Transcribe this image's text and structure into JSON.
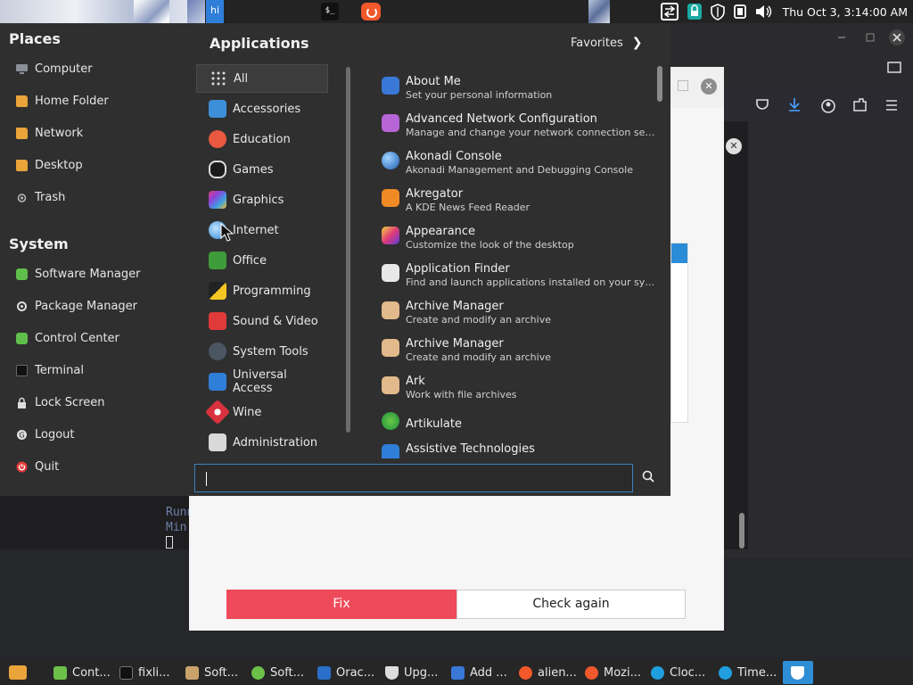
{
  "top_panel": {
    "hi_label": "hi",
    "term_icon_text": "$_",
    "clock": "Thu Oct  3,  3:14:00 AM"
  },
  "menu": {
    "places_title": "Places",
    "places": [
      {
        "label": "Computer",
        "icon": "computer-icon"
      },
      {
        "label": "Home Folder",
        "icon": "folder-icon"
      },
      {
        "label": "Network",
        "icon": "folder-icon"
      },
      {
        "label": "Desktop",
        "icon": "folder-icon"
      },
      {
        "label": "Trash",
        "icon": "trash-icon"
      }
    ],
    "system_title": "System",
    "system": [
      {
        "label": "Software Manager",
        "icon": "software-manager-icon"
      },
      {
        "label": "Package Manager",
        "icon": "package-manager-icon"
      },
      {
        "label": "Control Center",
        "icon": "control-center-icon"
      },
      {
        "label": "Terminal",
        "icon": "terminal-icon"
      },
      {
        "label": "Lock Screen",
        "icon": "lock-icon"
      },
      {
        "label": "Logout",
        "icon": "logout-icon"
      },
      {
        "label": "Quit",
        "icon": "power-icon"
      }
    ],
    "apps_title": "Applications",
    "favorites_label": "Favorites",
    "categories": [
      {
        "label": "All",
        "icon": "grid-icon"
      },
      {
        "label": "Accessories",
        "icon": "accessories-icon"
      },
      {
        "label": "Education",
        "icon": "education-icon"
      },
      {
        "label": "Games",
        "icon": "games-icon"
      },
      {
        "label": "Graphics",
        "icon": "graphics-icon"
      },
      {
        "label": "Internet",
        "icon": "internet-icon"
      },
      {
        "label": "Office",
        "icon": "office-icon"
      },
      {
        "label": "Programming",
        "icon": "programming-icon"
      },
      {
        "label": "Sound & Video",
        "icon": "sound-video-icon"
      },
      {
        "label": "System Tools",
        "icon": "system-tools-icon"
      },
      {
        "label": "Universal Access",
        "icon": "universal-access-icon"
      },
      {
        "label": "Wine",
        "icon": "wine-icon"
      },
      {
        "label": "Administration",
        "icon": "administration-icon"
      }
    ],
    "apps": [
      {
        "name": "About Me",
        "desc": "Set your personal information",
        "icon": "about-me-icon"
      },
      {
        "name": "Advanced Network Configuration",
        "desc": "Manage and change your network connection sett...",
        "icon": "network-config-icon"
      },
      {
        "name": "Akonadi Console",
        "desc": "Akonadi Management and Debugging Console",
        "icon": "akonadi-icon"
      },
      {
        "name": "Akregator",
        "desc": "A KDE News Feed Reader",
        "icon": "rss-icon"
      },
      {
        "name": "Appearance",
        "desc": "Customize the look of the desktop",
        "icon": "appearance-icon"
      },
      {
        "name": "Application Finder",
        "desc": "Find and launch applications installed on your sys...",
        "icon": "app-finder-icon"
      },
      {
        "name": "Archive Manager",
        "desc": "Create and modify an archive",
        "icon": "archive-icon"
      },
      {
        "name": "Archive Manager",
        "desc": "Create and modify an archive",
        "icon": "archive-icon"
      },
      {
        "name": "Ark",
        "desc": "Work with file archives",
        "icon": "archive-icon"
      },
      {
        "name": "Artikulate",
        "desc": "",
        "icon": "artikulate-icon"
      },
      {
        "name": "Assistive Technologies",
        "desc": "",
        "icon": "accessibility-icon"
      }
    ],
    "search_placeholder": ""
  },
  "dialog": {
    "fix_label": "Fix",
    "check_label": "Check again"
  },
  "terminal": {
    "lines": [
      "Runn",
      "Min"
    ]
  },
  "taskbar": [
    {
      "label": "",
      "icon": "files-icon"
    },
    {
      "label": "Cont...",
      "icon": "control-center-icon"
    },
    {
      "label": "fixli...",
      "icon": "terminal-icon"
    },
    {
      "label": "Soft...",
      "icon": "package-manager-icon"
    },
    {
      "label": "Soft...",
      "icon": "software-manager-icon"
    },
    {
      "label": "Orac...",
      "icon": "virtualbox-icon"
    },
    {
      "label": "Upg...",
      "icon": "shield-icon"
    },
    {
      "label": "Add ...",
      "icon": "monitor-icon"
    },
    {
      "label": "alien...",
      "icon": "firefox-icon"
    },
    {
      "label": "Mozi...",
      "icon": "firefox-icon"
    },
    {
      "label": "Cloc...",
      "icon": "clock-icon"
    },
    {
      "label": "Time...",
      "icon": "clock-icon"
    },
    {
      "label": "",
      "icon": "shield-icon"
    }
  ]
}
